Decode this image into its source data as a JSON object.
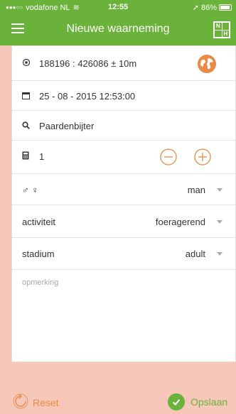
{
  "status": {
    "carrier": "vodafone NL",
    "time": "12:55",
    "battery": "86%"
  },
  "nav": {
    "title": "Nieuwe waarneming"
  },
  "form": {
    "location": "188196 : 426086 ± 10m",
    "datetime": "25 - 08 - 2015 12:53:00",
    "species": "Paardenbijter",
    "count": "1",
    "sex_label": "♂ ♀",
    "sex_value": "man",
    "activity_label": "activiteit",
    "activity_value": "foeragerend",
    "stage_label": "stadium",
    "stage_value": "adult",
    "note_placeholder": "opmerking"
  },
  "actions": {
    "reset_label": "Reset",
    "save_label": "Opslaan"
  },
  "colors": {
    "brand_green": "#6ab23a",
    "accent_orange": "#e98a45",
    "background": "#f7c7b9"
  }
}
